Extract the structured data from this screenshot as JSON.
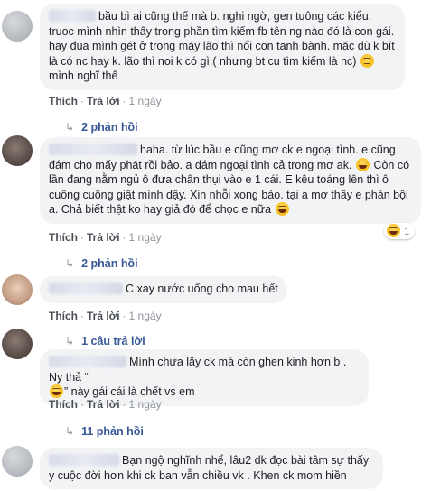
{
  "comments": [
    {
      "text": "bầu bì ai cũng thế mà b. nghi ngờ, gen tuông các kiểu. truoc mình nhìn thấy trong phần tìm kiếm fb tên ng nào đó là con gái. hay đua mình gét ở trong máy lão thì nổi con tanh bành. mặc dù k bít là có nc hay k. lão thì noi k có gì.( nhưng bt cu tìm kiếm là nc)",
      "text_tail": "mình nghĩ thế",
      "emoji": "neutral-face-emoji",
      "like_label": "Thích",
      "reply_label": "Trả lời",
      "time": "1 ngày",
      "replies_label": "2 phản hồi"
    },
    {
      "text": "haha. từ lúc bầu e cũng mơ ck e ngoại tình. e cũng đám cho mấy phát rồi bảo. a dám ngoại tình cả trong mơ ak.",
      "text_2": "Còn có lần đang nằm ngủ ô đưa chân thụi vào e 1 cái. E kêu toáng lên thì ô cuống cuồng giật mình dậy. Xin nhỗi xong bảo. tại a mơ thấy e phản bội a. Chả biết thật ko hay giả đò để chọc e nữa",
      "emoji": "grinning-squint-emoji",
      "like_label": "Thích",
      "reply_label": "Trả lời",
      "time": "1 ngày",
      "reaction_count": "1",
      "replies_label": "2 phản hồi"
    },
    {
      "text": "C xay nước uống cho mau hết",
      "like_label": "Thích",
      "reply_label": "Trả lời",
      "time": "1 ngày",
      "replies_label": "1 câu trả lời"
    },
    {
      "text": "Mình chưa lấy ck mà còn ghen kinh hơn b . Ny thả “",
      "text_2": "” này gái cái là chết vs em",
      "emoji": "grinning-squint-emoji",
      "like_label": "Thích",
      "reply_label": "Trả lời",
      "time": "1 ngày",
      "replies_label": "11 phản hồi"
    },
    {
      "text": "Bạn ngộ nghĩnh nhể, lâu2 dk đọc bài tâm sự thấy y cuộc đời hơn khi ck ban vẫn chiều vk . Khen ck mom hiền"
    }
  ],
  "separator": "·"
}
